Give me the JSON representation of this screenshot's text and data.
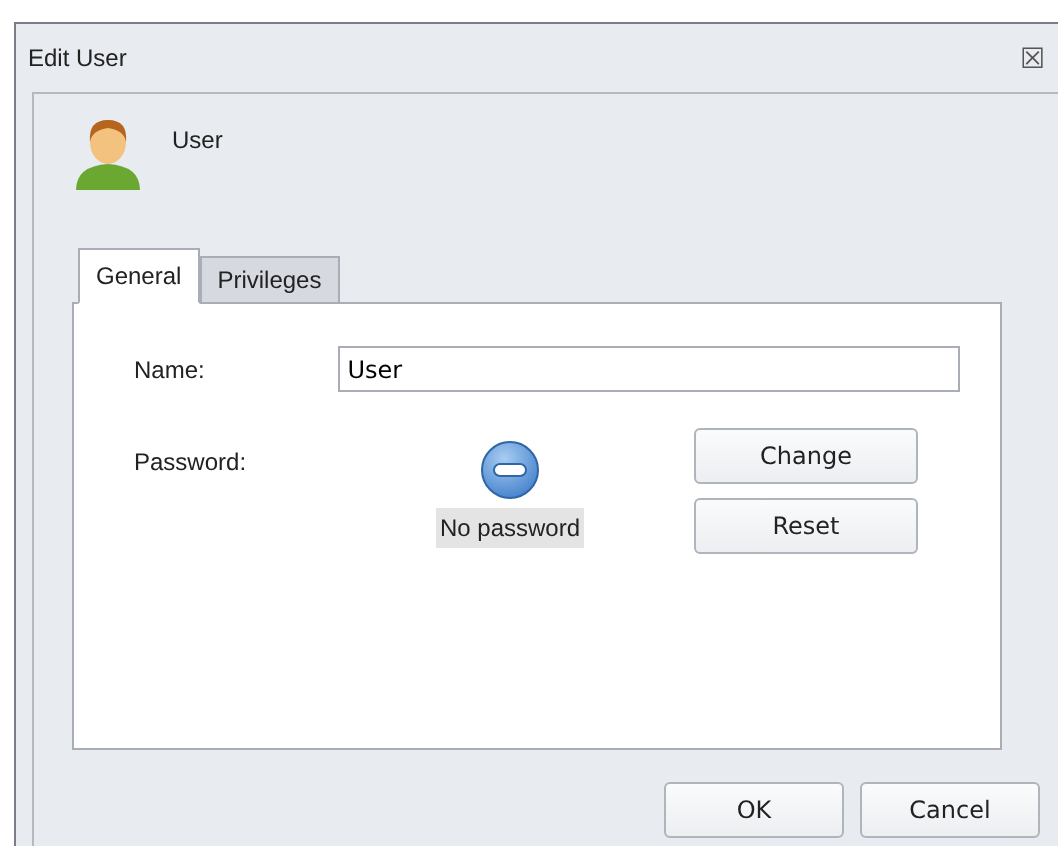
{
  "window": {
    "title": "Edit User",
    "close": "☒"
  },
  "user": {
    "name": "User"
  },
  "tabs": [
    {
      "label": "General",
      "selected": true
    },
    {
      "label": "Privileges",
      "selected": false
    }
  ],
  "general": {
    "name_label": "Name:",
    "name_value": "User",
    "password_label": "Password:",
    "password_status": "No password",
    "buttons": [
      "Change",
      "Reset"
    ]
  },
  "buttons": [
    "OK",
    "Cancel"
  ]
}
